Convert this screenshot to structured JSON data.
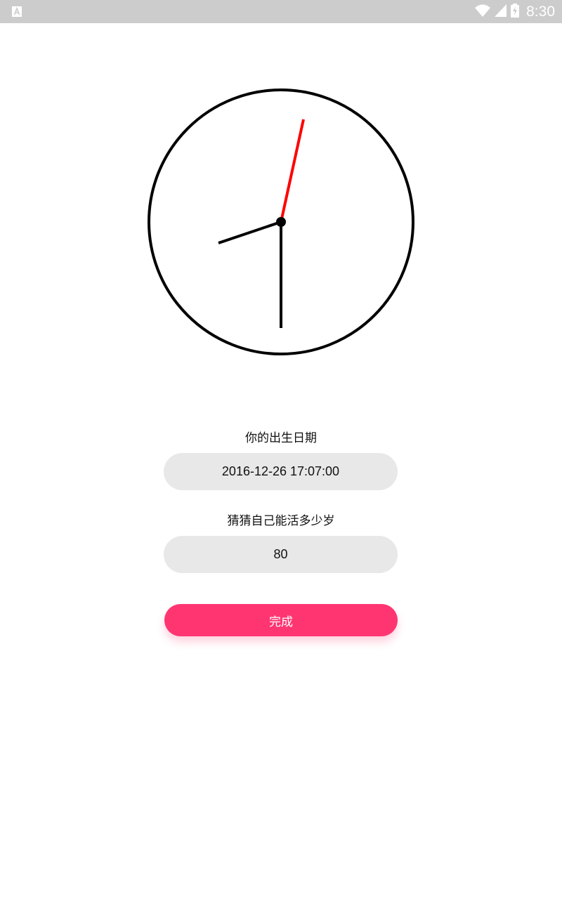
{
  "status_bar": {
    "time": "8:30",
    "left_icon": "app-notification-icon",
    "icons": [
      "wifi-icon",
      "cell-signal-icon",
      "battery-charging-icon"
    ]
  },
  "clock": {
    "icon": "analog-clock",
    "hour_hand_color": "#000000",
    "minute_hand_color": "#000000",
    "second_hand_color": "#ff0000"
  },
  "form": {
    "birth_label": "你的出生日期",
    "birth_value": "2016-12-26 17:07:00",
    "age_label": "猜猜自己能活多少岁",
    "age_value": "80",
    "submit_label": "完成"
  },
  "colors": {
    "status_bar": "#cccccc",
    "input_background": "#e8e8e8",
    "accent": "#ff3572"
  }
}
